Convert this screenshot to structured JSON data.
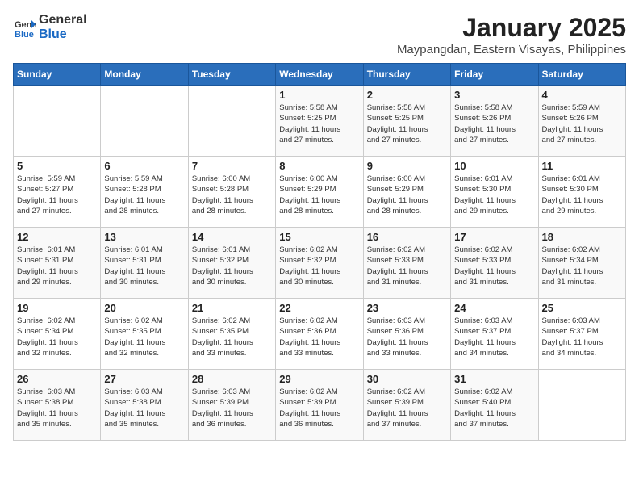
{
  "logo": {
    "general": "General",
    "blue": "Blue"
  },
  "title": "January 2025",
  "subtitle": "Maypangdan, Eastern Visayas, Philippines",
  "weekdays": [
    "Sunday",
    "Monday",
    "Tuesday",
    "Wednesday",
    "Thursday",
    "Friday",
    "Saturday"
  ],
  "weeks": [
    [
      {
        "day": "",
        "info": ""
      },
      {
        "day": "",
        "info": ""
      },
      {
        "day": "",
        "info": ""
      },
      {
        "day": "1",
        "info": "Sunrise: 5:58 AM\nSunset: 5:25 PM\nDaylight: 11 hours\nand 27 minutes."
      },
      {
        "day": "2",
        "info": "Sunrise: 5:58 AM\nSunset: 5:25 PM\nDaylight: 11 hours\nand 27 minutes."
      },
      {
        "day": "3",
        "info": "Sunrise: 5:58 AM\nSunset: 5:26 PM\nDaylight: 11 hours\nand 27 minutes."
      },
      {
        "day": "4",
        "info": "Sunrise: 5:59 AM\nSunset: 5:26 PM\nDaylight: 11 hours\nand 27 minutes."
      }
    ],
    [
      {
        "day": "5",
        "info": "Sunrise: 5:59 AM\nSunset: 5:27 PM\nDaylight: 11 hours\nand 27 minutes."
      },
      {
        "day": "6",
        "info": "Sunrise: 5:59 AM\nSunset: 5:28 PM\nDaylight: 11 hours\nand 28 minutes."
      },
      {
        "day": "7",
        "info": "Sunrise: 6:00 AM\nSunset: 5:28 PM\nDaylight: 11 hours\nand 28 minutes."
      },
      {
        "day": "8",
        "info": "Sunrise: 6:00 AM\nSunset: 5:29 PM\nDaylight: 11 hours\nand 28 minutes."
      },
      {
        "day": "9",
        "info": "Sunrise: 6:00 AM\nSunset: 5:29 PM\nDaylight: 11 hours\nand 28 minutes."
      },
      {
        "day": "10",
        "info": "Sunrise: 6:01 AM\nSunset: 5:30 PM\nDaylight: 11 hours\nand 29 minutes."
      },
      {
        "day": "11",
        "info": "Sunrise: 6:01 AM\nSunset: 5:30 PM\nDaylight: 11 hours\nand 29 minutes."
      }
    ],
    [
      {
        "day": "12",
        "info": "Sunrise: 6:01 AM\nSunset: 5:31 PM\nDaylight: 11 hours\nand 29 minutes."
      },
      {
        "day": "13",
        "info": "Sunrise: 6:01 AM\nSunset: 5:31 PM\nDaylight: 11 hours\nand 30 minutes."
      },
      {
        "day": "14",
        "info": "Sunrise: 6:01 AM\nSunset: 5:32 PM\nDaylight: 11 hours\nand 30 minutes."
      },
      {
        "day": "15",
        "info": "Sunrise: 6:02 AM\nSunset: 5:32 PM\nDaylight: 11 hours\nand 30 minutes."
      },
      {
        "day": "16",
        "info": "Sunrise: 6:02 AM\nSunset: 5:33 PM\nDaylight: 11 hours\nand 31 minutes."
      },
      {
        "day": "17",
        "info": "Sunrise: 6:02 AM\nSunset: 5:33 PM\nDaylight: 11 hours\nand 31 minutes."
      },
      {
        "day": "18",
        "info": "Sunrise: 6:02 AM\nSunset: 5:34 PM\nDaylight: 11 hours\nand 31 minutes."
      }
    ],
    [
      {
        "day": "19",
        "info": "Sunrise: 6:02 AM\nSunset: 5:34 PM\nDaylight: 11 hours\nand 32 minutes."
      },
      {
        "day": "20",
        "info": "Sunrise: 6:02 AM\nSunset: 5:35 PM\nDaylight: 11 hours\nand 32 minutes."
      },
      {
        "day": "21",
        "info": "Sunrise: 6:02 AM\nSunset: 5:35 PM\nDaylight: 11 hours\nand 33 minutes."
      },
      {
        "day": "22",
        "info": "Sunrise: 6:02 AM\nSunset: 5:36 PM\nDaylight: 11 hours\nand 33 minutes."
      },
      {
        "day": "23",
        "info": "Sunrise: 6:03 AM\nSunset: 5:36 PM\nDaylight: 11 hours\nand 33 minutes."
      },
      {
        "day": "24",
        "info": "Sunrise: 6:03 AM\nSunset: 5:37 PM\nDaylight: 11 hours\nand 34 minutes."
      },
      {
        "day": "25",
        "info": "Sunrise: 6:03 AM\nSunset: 5:37 PM\nDaylight: 11 hours\nand 34 minutes."
      }
    ],
    [
      {
        "day": "26",
        "info": "Sunrise: 6:03 AM\nSunset: 5:38 PM\nDaylight: 11 hours\nand 35 minutes."
      },
      {
        "day": "27",
        "info": "Sunrise: 6:03 AM\nSunset: 5:38 PM\nDaylight: 11 hours\nand 35 minutes."
      },
      {
        "day": "28",
        "info": "Sunrise: 6:03 AM\nSunset: 5:39 PM\nDaylight: 11 hours\nand 36 minutes."
      },
      {
        "day": "29",
        "info": "Sunrise: 6:02 AM\nSunset: 5:39 PM\nDaylight: 11 hours\nand 36 minutes."
      },
      {
        "day": "30",
        "info": "Sunrise: 6:02 AM\nSunset: 5:39 PM\nDaylight: 11 hours\nand 37 minutes."
      },
      {
        "day": "31",
        "info": "Sunrise: 6:02 AM\nSunset: 5:40 PM\nDaylight: 11 hours\nand 37 minutes."
      },
      {
        "day": "",
        "info": ""
      }
    ]
  ]
}
